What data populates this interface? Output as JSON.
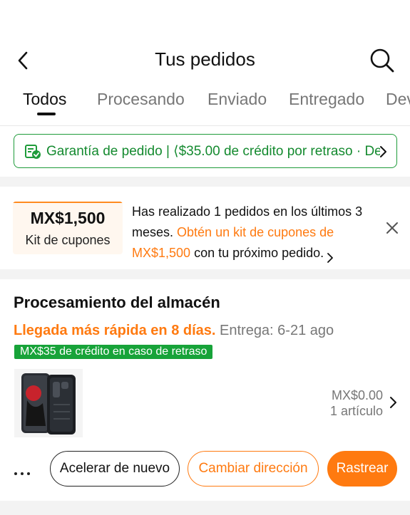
{
  "header": {
    "title": "Tus pedidos"
  },
  "tabs": [
    {
      "label": "Todos"
    },
    {
      "label": "Procesando"
    },
    {
      "label": "Enviado"
    },
    {
      "label": "Entregado"
    },
    {
      "label": "Dev"
    }
  ],
  "guarantee": {
    "text": "Garantía de pedido  |  ⟨$35.00 de crédito por retraso · Devoluciones"
  },
  "coupon": {
    "amount": "MX$1,500",
    "label": "Kit de cupones",
    "message_prefix": "Has realizado 1 pedidos en los últimos 3 meses. ",
    "message_highlight": "Obtén un kit de cupones de MX$1,500",
    "message_suffix": " con tu próximo pedido."
  },
  "order": {
    "status": "Procesamiento del almacén",
    "delivery_fast": "Llegada más rápida en 8 días.",
    "delivery_range": " Entrega: 6-21 ago",
    "delay_badge": "MX$35 de crédito en caso de retraso",
    "price": "MX$0.00",
    "item_count": "1 artículo",
    "buttons": {
      "accelerate": "Acelerar de nuevo",
      "change_address": "Cambiar dirección",
      "track": "Rastrear"
    }
  },
  "colors": {
    "accent_orange": "#ff7a10",
    "guarantee_green": "#148a2f",
    "badge_green": "#17a339"
  },
  "icons": [
    "back-arrow-icon",
    "search-icon",
    "shield-check-icon",
    "chevron-right-icon",
    "close-icon",
    "more-dots-icon"
  ]
}
